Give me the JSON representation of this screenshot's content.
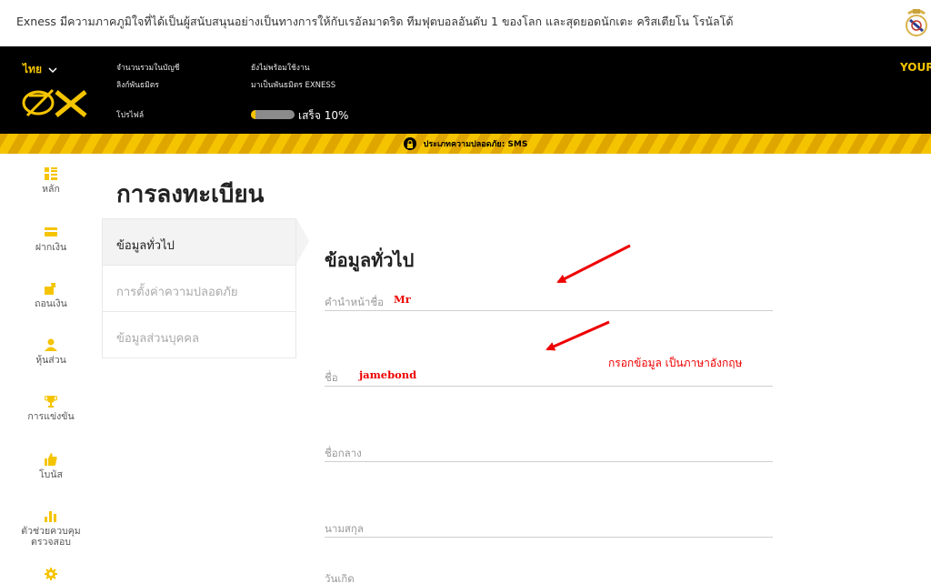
{
  "banner": {
    "text": "Exness มีความภาคภูมิใจที่ได้เป็นผู้สนับสนุนอย่างเป็นทางการให้กับเรอัลมาดริด ทีมฟุตบอลอันดับ 1 ของโลก และสุดยอดนักเตะ คริสเตียโน โรนัลโด้",
    "badge_icon": "real-madrid-crest-icon"
  },
  "header": {
    "language": "ไทย",
    "logo": "EX",
    "total_accounts_label": "จำนวนรวมในบัญชี",
    "total_accounts_value": "ยังไม่พร้อมใช้งาน",
    "partner_link_label": "ลิงก์พันธมิตร",
    "partner_link_value": "มาเป็นพันธมิตร EXNESS",
    "profile_label": "โปรไฟล์",
    "profile_progress": 0.1,
    "profile_progress_text": "เสร็จ 10%",
    "right_text": "YOUR"
  },
  "security_bar": {
    "text": "ประเภทความปลอดภัย: SMS"
  },
  "sidebar": {
    "items": [
      {
        "label": "หลัก",
        "icon": "dashboard-icon"
      },
      {
        "label": "ฝากเงิน",
        "icon": "card-icon"
      },
      {
        "label": "ถอนเงิน",
        "icon": "withdraw-icon"
      },
      {
        "label": "หุ้นส่วน",
        "icon": "user-icon"
      },
      {
        "label": "การแข่งขัน",
        "icon": "trophy-icon"
      },
      {
        "label": "โบนัส",
        "icon": "thumbs-up-icon"
      },
      {
        "label": "ตัวช่วยควบคุม",
        "label2": "ตรวจสอบ",
        "icon": "bar-chart-icon"
      },
      {
        "label": "",
        "icon": "gear-icon"
      }
    ]
  },
  "main": {
    "title": "การลงทะเบียน",
    "subnav": [
      "ข้อมูลทั่วไป",
      "การตั้งค่าความปลอดภัย",
      "ข้อมูลส่วนบุคคล"
    ],
    "section_title": "ข้อมูลทั่วไป",
    "fields": [
      {
        "label": "คำนำหน้าชื่อ",
        "value": "Mr"
      },
      {
        "label": "ชื่อ",
        "value": "jamebond"
      },
      {
        "label": "ชื่อกลาง",
        "value": ""
      },
      {
        "label": "นามสกุล",
        "value": ""
      },
      {
        "label": "วันเกิด",
        "value": ""
      }
    ],
    "annotation": "กรอกข้อมูล เป็นภาษาอังกฤษ"
  },
  "colors": {
    "brand_yellow": "#f5c400",
    "header_bg": "#000000",
    "annotation_red": "#e00000"
  }
}
